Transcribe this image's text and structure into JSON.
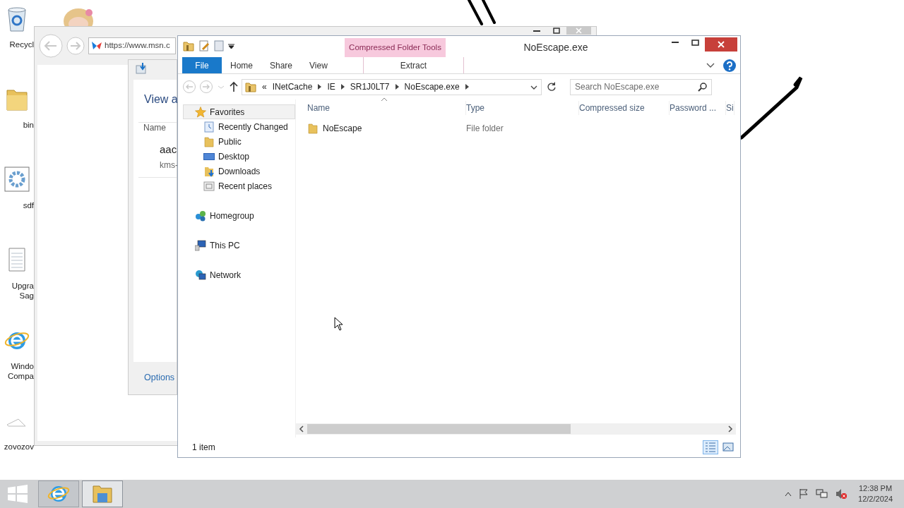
{
  "desktop_icons": [
    {
      "kind": "recycle",
      "lines": [
        "Recycl"
      ]
    },
    {
      "kind": "folder",
      "lines": [
        "bin"
      ]
    },
    {
      "kind": "settings",
      "lines": [
        "sdf"
      ]
    },
    {
      "kind": "document",
      "lines": [
        "Upgra",
        "Sag"
      ]
    },
    {
      "kind": "browser",
      "lines": [
        "Windo",
        "Compa"
      ]
    },
    {
      "kind": "sketch",
      "lines": [
        "zovozov"
      ]
    }
  ],
  "browser_window": {
    "address": "https://www.msn.c",
    "downloads_dialog": {
      "title": "View a",
      "column": "Name",
      "item_name": "aac",
      "item_detail": "kms-",
      "options_link": "Options"
    }
  },
  "explorer": {
    "title": "NoEscape.exe",
    "contextual_group": "Compressed Folder Tools",
    "ribbon_tabs": [
      {
        "label": "File",
        "kind": "file",
        "selected": false
      },
      {
        "label": "Home",
        "kind": "tab",
        "selected": false
      },
      {
        "label": "Share",
        "kind": "tab",
        "selected": false
      },
      {
        "label": "View",
        "kind": "tab",
        "selected": false
      },
      {
        "label": "Extract",
        "kind": "contextual",
        "selected": false
      }
    ],
    "breadcrumb": [
      "«",
      "INetCache",
      "IE",
      "SR1J0LT7",
      "NoEscape.exe"
    ],
    "search": {
      "placeholder": "Search NoEscape.exe"
    },
    "navigation": [
      {
        "label": "Favorites",
        "kind": "star",
        "selected": true,
        "children": [
          {
            "label": "Recently Changed",
            "kind": "recent",
            "selected": false
          },
          {
            "label": "Public",
            "kind": "folder",
            "selected": false
          },
          {
            "label": "Desktop",
            "kind": "desktop",
            "selected": false
          },
          {
            "label": "Downloads",
            "kind": "downloads",
            "selected": false
          },
          {
            "label": "Recent places",
            "kind": "places",
            "selected": false
          }
        ]
      },
      {
        "label": "Homegroup",
        "kind": "homegroup",
        "selected": false
      },
      {
        "label": "This PC",
        "kind": "pc",
        "selected": false
      },
      {
        "label": "Network",
        "kind": "network",
        "selected": false
      }
    ],
    "columns": [
      "Name",
      "Type",
      "Compressed size",
      "Password ...",
      "Si"
    ],
    "rows": [
      {
        "name": "NoEscape",
        "type": "File folder"
      }
    ],
    "status": "1 item",
    "views": [
      {
        "kind": "details",
        "selected": true
      },
      {
        "kind": "large",
        "selected": false
      }
    ]
  },
  "taskbar": {
    "buttons": [
      {
        "kind": "browser",
        "active": false
      },
      {
        "kind": "explorer",
        "active": true
      }
    ],
    "time": "12:38 PM",
    "date": "12/2/2024"
  }
}
